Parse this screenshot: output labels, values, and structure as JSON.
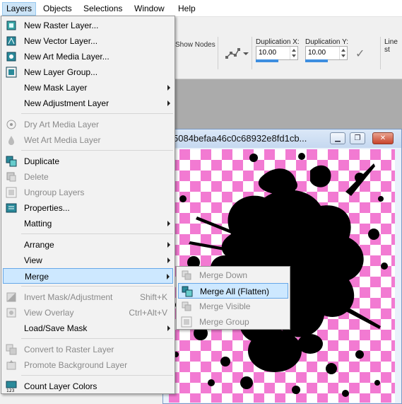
{
  "menubar": {
    "items": [
      "Layers",
      "Objects",
      "Selections",
      "Window",
      "Help"
    ]
  },
  "toolbar": {
    "show_nodes": "Show Nodes",
    "dup_x_label": "Duplication X:",
    "dup_x_value": "10.00",
    "dup_y_label": "Duplication Y:",
    "dup_y_value": "10.00",
    "line_style_label": "Line st"
  },
  "document": {
    "title": "5084befaa46c0c68932e8fd1cb...",
    "colors": {
      "checker": "#f27ad2",
      "splat": "#000000"
    }
  },
  "layers_menu": {
    "items": [
      {
        "label": "New Raster Layer...",
        "icon": "raster-layer-icon",
        "enabled": true
      },
      {
        "label": "New Vector Layer...",
        "icon": "vector-layer-icon",
        "enabled": true
      },
      {
        "label": "New Art Media Layer...",
        "icon": "art-media-layer-icon",
        "enabled": true
      },
      {
        "label": "New Layer Group...",
        "icon": "layer-group-icon",
        "enabled": true
      },
      {
        "label": "New Mask Layer",
        "enabled": true,
        "submenu": true
      },
      {
        "label": "New Adjustment Layer",
        "enabled": true,
        "submenu": true
      },
      {
        "label": "Dry Art Media Layer",
        "icon": "dry-media-icon",
        "enabled": false
      },
      {
        "label": "Wet Art Media Layer",
        "icon": "wet-media-icon",
        "enabled": false
      },
      {
        "label": "Duplicate",
        "icon": "duplicate-icon",
        "enabled": true
      },
      {
        "label": "Delete",
        "icon": "delete-icon",
        "enabled": false
      },
      {
        "label": "Ungroup Layers",
        "icon": "ungroup-icon",
        "enabled": false
      },
      {
        "label": "Properties...",
        "icon": "properties-icon",
        "enabled": true
      },
      {
        "label": "Matting",
        "enabled": true,
        "submenu": true
      },
      {
        "label": "Arrange",
        "enabled": true,
        "submenu": true
      },
      {
        "label": "View",
        "enabled": true,
        "submenu": true
      },
      {
        "label": "Merge",
        "enabled": true,
        "submenu": true,
        "highlighted": true
      },
      {
        "label": "Invert Mask/Adjustment",
        "shortcut": "Shift+K",
        "icon": "invert-mask-icon",
        "enabled": false
      },
      {
        "label": "View Overlay",
        "shortcut": "Ctrl+Alt+V",
        "icon": "view-overlay-icon",
        "enabled": false
      },
      {
        "label": "Load/Save Mask",
        "enabled": true,
        "submenu": true
      },
      {
        "label": "Convert to Raster Layer",
        "icon": "convert-raster-icon",
        "enabled": false
      },
      {
        "label": "Promote Background Layer",
        "icon": "promote-background-icon",
        "enabled": false
      },
      {
        "label": "Count Layer Colors",
        "icon": "count-colors-icon",
        "enabled": true
      }
    ]
  },
  "merge_submenu": {
    "items": [
      {
        "label": "Merge Down",
        "icon": "merge-down-icon",
        "enabled": false
      },
      {
        "label": "Merge All (Flatten)",
        "icon": "merge-all-icon",
        "enabled": true,
        "highlighted": true
      },
      {
        "label": "Merge Visible",
        "icon": "merge-visible-icon",
        "enabled": false
      },
      {
        "label": "Merge Group",
        "icon": "merge-group-icon",
        "enabled": false
      }
    ]
  }
}
